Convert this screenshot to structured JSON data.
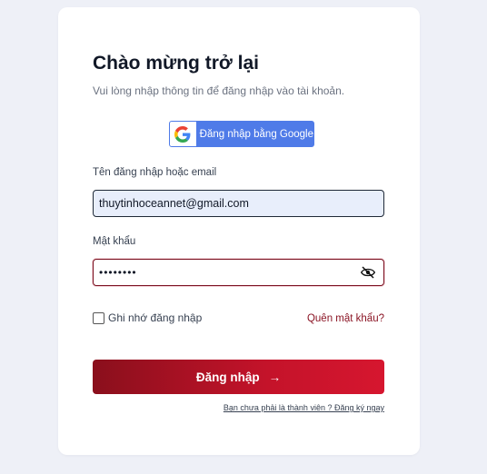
{
  "login": {
    "title": "Chào mừng trở lại",
    "subtitle": "Vui lòng nhập thông tin để đăng nhập vào tài khoản.",
    "google_button": "Đăng nhập bằng Google",
    "username_label": "Tên đăng nhập hoặc email",
    "username_value": "thuytinhoceannet@gmail.com",
    "password_label": "Mật khẩu",
    "password_value": "••••••••",
    "remember_label": "Ghi nhớ đăng nhập",
    "remember_checked": false,
    "forgot_link": "Quên mật khẩu?",
    "submit_label": "Đăng nhập",
    "submit_arrow": "→",
    "register_link": "Bạn chưa phải là thành viên ? Đăng ký ngay"
  },
  "colors": {
    "background": "#eef0f7",
    "card": "#ffffff",
    "google_blue": "#4f7be8",
    "brand_red": "#c4132a",
    "brand_dark_red": "#8a0f1c",
    "email_field_bg": "#e8eefb"
  },
  "icons": {
    "google": "google-g-icon",
    "password_toggle": "eye-slash-icon",
    "submit": "arrow-right-icon"
  }
}
